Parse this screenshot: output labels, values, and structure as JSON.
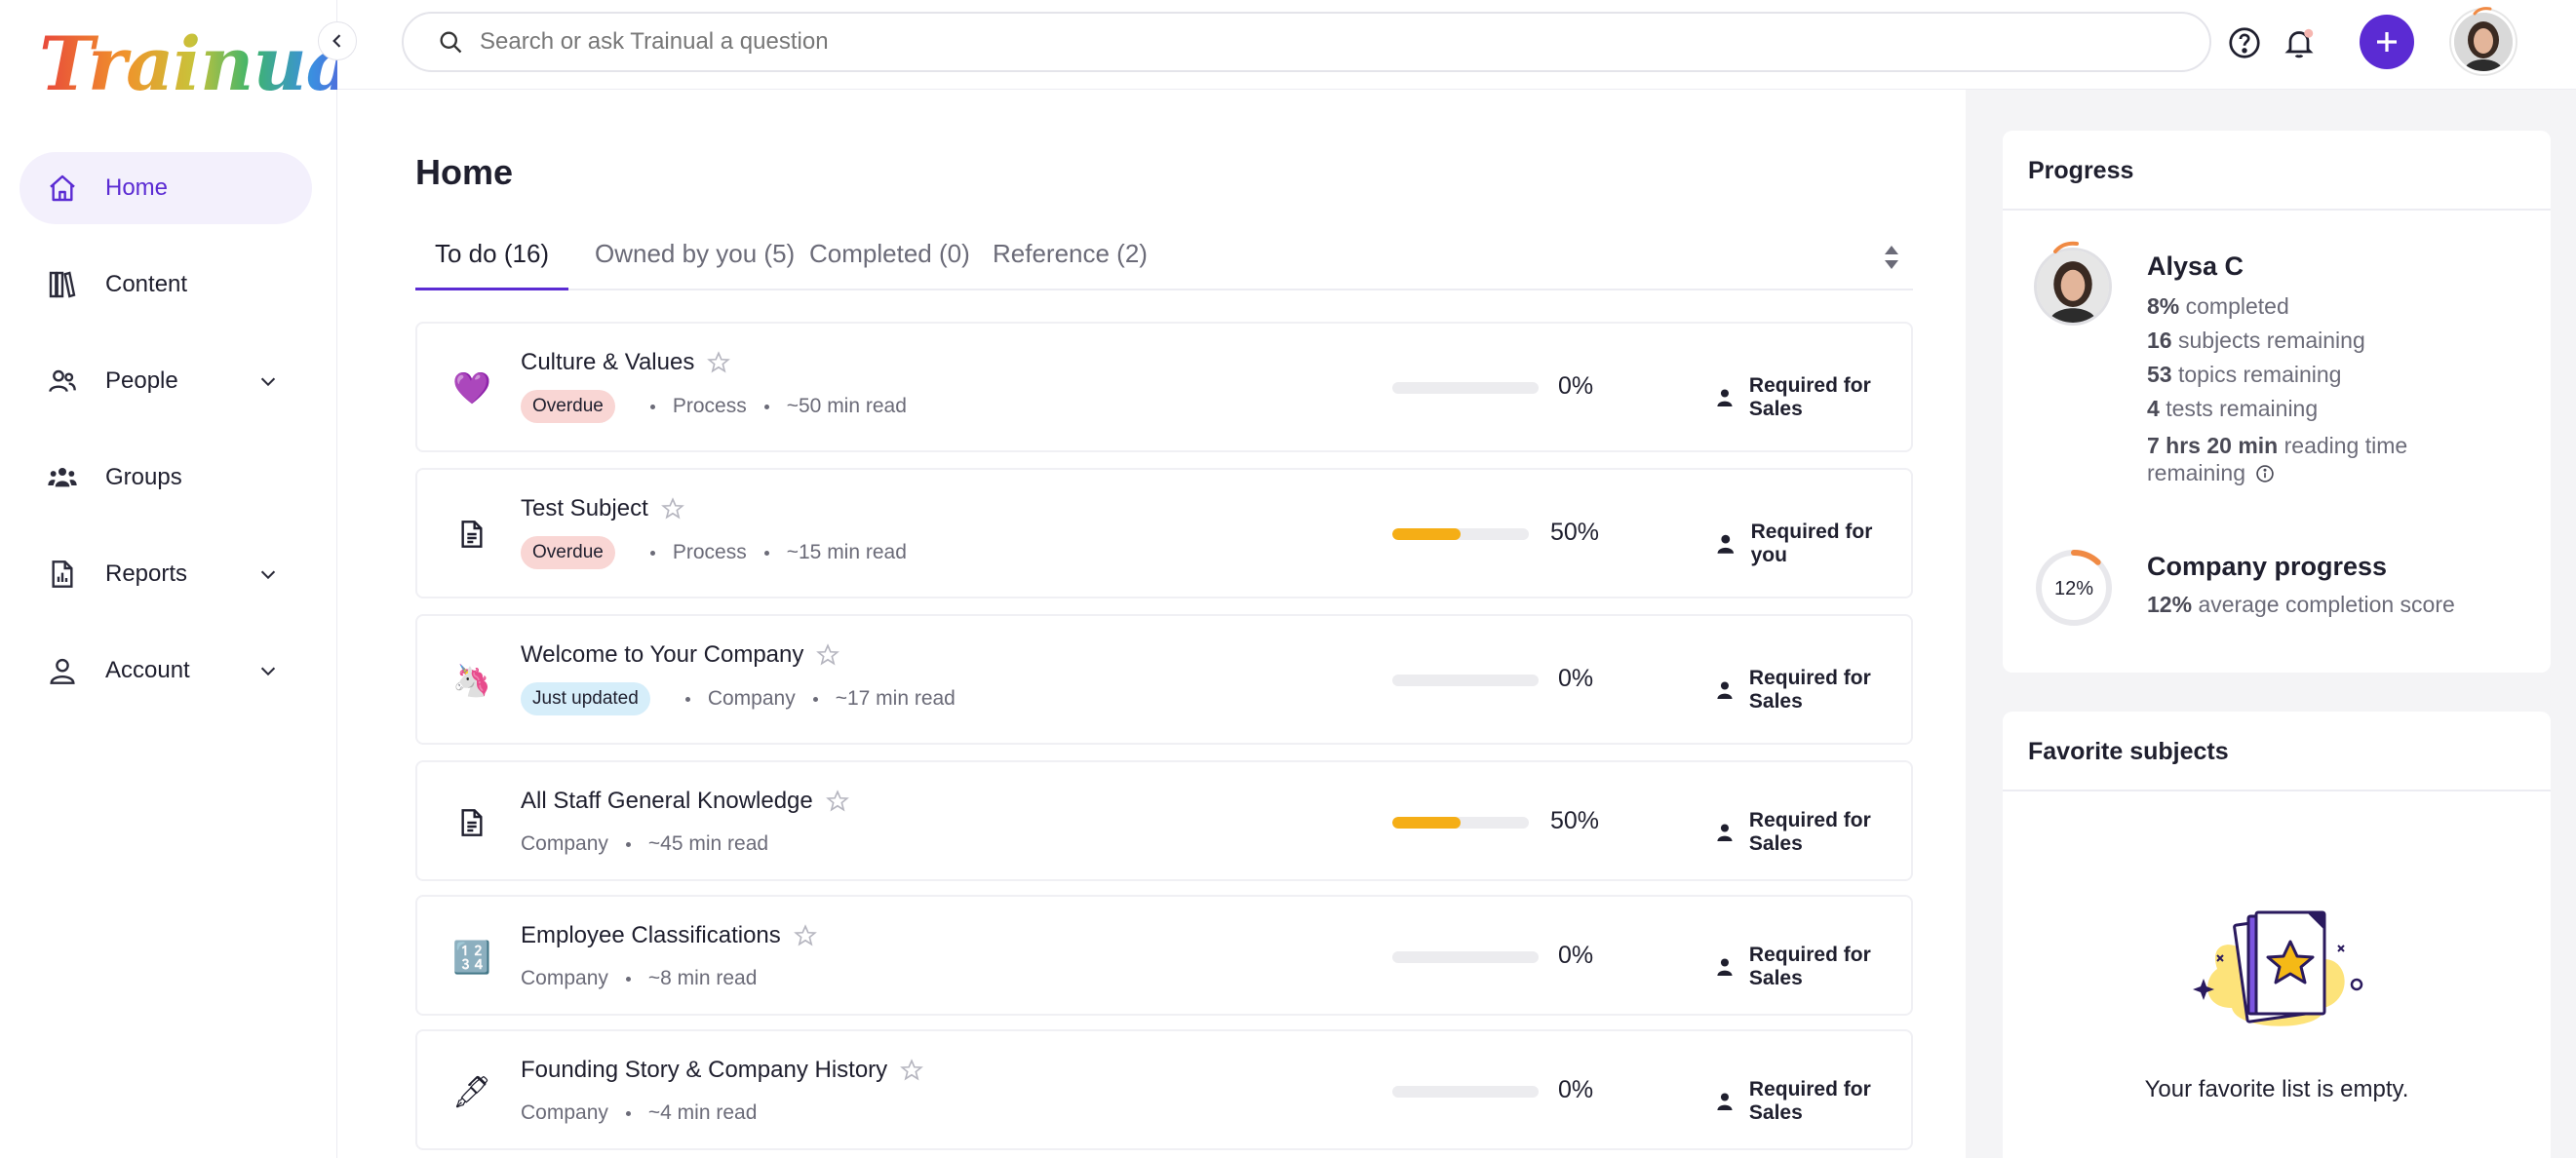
{
  "sidebar": {
    "logo": "Trainual",
    "items": [
      {
        "label": "Home",
        "icon": "home-icon",
        "active": true
      },
      {
        "label": "Content",
        "icon": "books-icon"
      },
      {
        "label": "People",
        "icon": "people-icon",
        "expandable": true
      },
      {
        "label": "Groups",
        "icon": "groups-icon"
      },
      {
        "label": "Reports",
        "icon": "report-icon",
        "expandable": true
      },
      {
        "label": "Account",
        "icon": "account-icon",
        "expandable": true
      }
    ]
  },
  "topbar": {
    "search_placeholder": "Search or ask Trainual a question"
  },
  "main": {
    "title": "Home",
    "tabs": [
      {
        "label": "To do (16)",
        "active": true
      },
      {
        "label": "Owned by you (5)"
      },
      {
        "label": "Completed (0)"
      },
      {
        "label": "Reference (2)"
      }
    ],
    "subjects": [
      {
        "emoji": "💜",
        "title": "Culture & Values",
        "badge": "Overdue",
        "badge_type": "overdue",
        "meta": [
          "Process",
          "~50 min read"
        ],
        "progress": 0,
        "progress_label": "0%",
        "requirement": "Required for Sales"
      },
      {
        "emoji": "📄",
        "title": "Test Subject",
        "badge": "Overdue",
        "badge_type": "overdue",
        "meta": [
          "Process",
          "~15 min read"
        ],
        "progress": 50,
        "progress_label": "50%",
        "requirement": "Required for you"
      },
      {
        "emoji": "🦄",
        "title": "Welcome to Your Company",
        "badge": "Just updated",
        "badge_type": "updated",
        "meta": [
          "Company",
          "~17 min read"
        ],
        "progress": 0,
        "progress_label": "0%",
        "requirement": "Required for Sales"
      },
      {
        "emoji": "📄",
        "title": "All Staff General Knowledge",
        "badge": "",
        "badge_type": "",
        "meta": [
          "Company",
          "~45 min read"
        ],
        "progress": 50,
        "progress_label": "50%",
        "requirement": "Required for Sales"
      },
      {
        "emoji": "🔢",
        "title": "Employee Classifications",
        "badge": "",
        "badge_type": "",
        "meta": [
          "Company",
          "~8 min read"
        ],
        "progress": 0,
        "progress_label": "0%",
        "requirement": "Required for Sales"
      },
      {
        "emoji": "🖋",
        "title": "Founding Story & Company History",
        "badge": "",
        "badge_type": "",
        "meta": [
          "Company",
          "~4 min read"
        ],
        "progress": 0,
        "progress_label": "0%",
        "requirement": "Required for Sales"
      }
    ]
  },
  "progress_panel": {
    "title": "Progress",
    "user_name": "Alysa C",
    "completed_value": "8%",
    "completed_text": "completed",
    "subjects_value": "16",
    "subjects_text": "subjects remaining",
    "topics_value": "53",
    "topics_text": "topics remaining",
    "tests_value": "4",
    "tests_text": "tests remaining",
    "reading_value": "7 hrs 20 min",
    "reading_text": "reading time",
    "reading_text2": "remaining",
    "company_title": "Company progress",
    "company_pct": "12%",
    "company_value": "12%",
    "company_text": "average completion score",
    "company_progress": 12
  },
  "favorites_panel": {
    "title": "Favorite subjects",
    "empty_text": "Your favorite list is empty."
  },
  "colors": {
    "accent": "#5b2bd3",
    "progress_fill": "#f5ae16",
    "overdue_badge": "#f9d6d4",
    "updated_badge": "#d6eefa"
  }
}
